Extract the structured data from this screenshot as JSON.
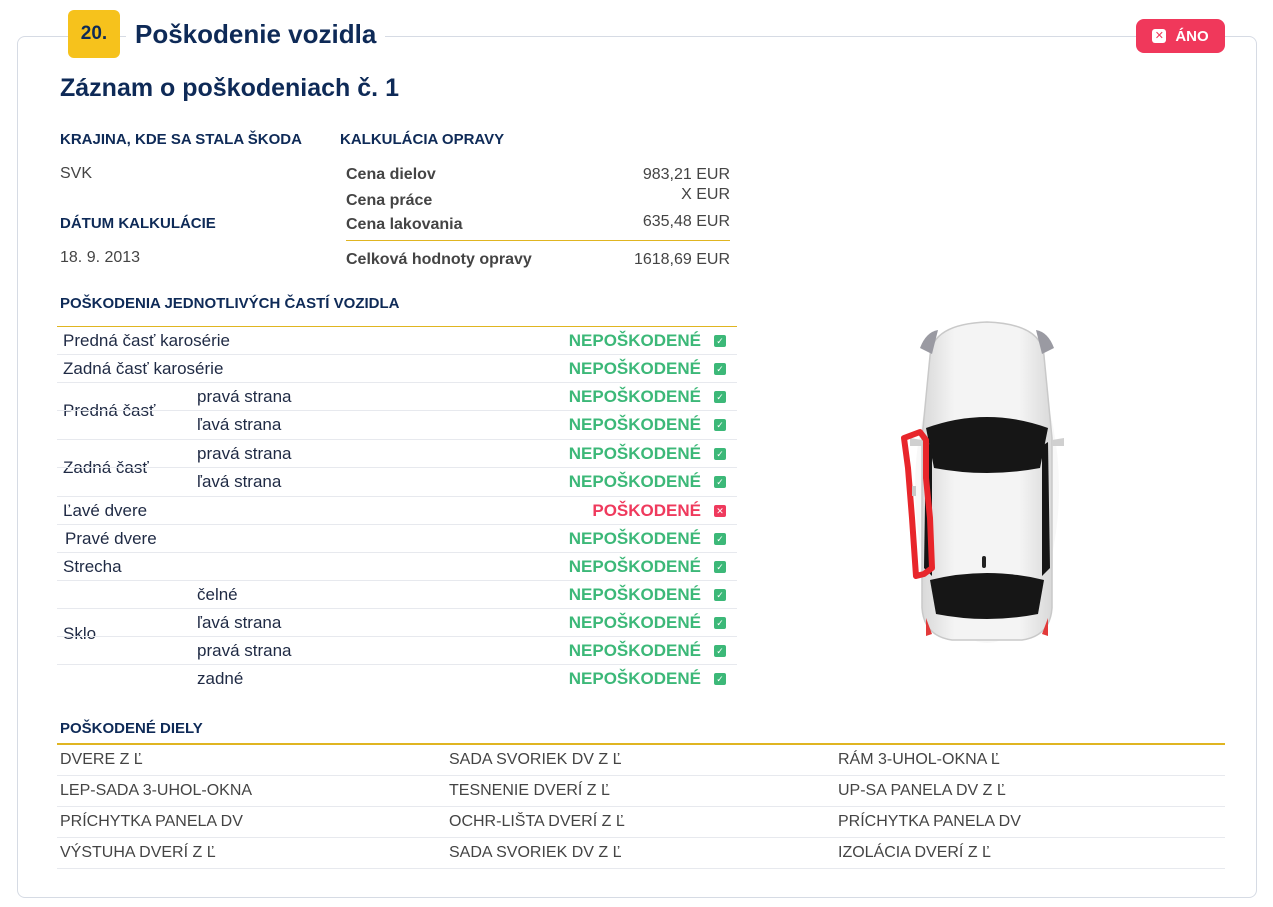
{
  "section": {
    "number": "20.",
    "title": "Poškodenie vozidla",
    "status_label": "ÁNO",
    "status_color": "#f0385b"
  },
  "record_title": "Záznam o poškodeniach č. 1",
  "country": {
    "label": "KRAJINA, KDE SA STALA ŠKODA",
    "value": "SVK"
  },
  "calc_date": {
    "label": "DÁTUM KALKULÁCIE",
    "value": "18. 9. 2013"
  },
  "calculation": {
    "label": "KALKULÁCIA OPRAVY",
    "rows": [
      {
        "name": "Cena dielov",
        "value": "983,21 EUR"
      },
      {
        "name": "Cena práce",
        "value": "X EUR"
      },
      {
        "name": "Cena lakovania",
        "value": "635,48 EUR"
      }
    ],
    "total": {
      "name": "Celková hodnoty opravy",
      "value": "1618,69 EUR"
    }
  },
  "parts": {
    "label": "POŠKODENIA JEDNOTLIVÝCH ČASTÍ VOZIDLA",
    "ok_text": "NEPOŠKODENÉ",
    "bad_text": "POŠKODENÉ",
    "ok_color": "#3cb878",
    "bad_color": "#ef3a5d",
    "front_body": "Predná časť karosérie",
    "rear_body": "Zadná časť karosérie",
    "front": {
      "name": "Predná časť",
      "right": "pravá strana",
      "left": "ľavá strana"
    },
    "rear": {
      "name": "Zadná časť",
      "right": "pravá strana",
      "left": "ľavá strana"
    },
    "left_door": "Ľavé dvere",
    "right_door": "Pravé dvere",
    "roof": "Strecha",
    "glass": {
      "name": "Sklo",
      "front": "čelné",
      "left": "ľavá strana",
      "right": "pravá strana",
      "rear": "zadné"
    }
  },
  "damaged_parts": {
    "label": "POŠKODENÉ DIELY",
    "rows": [
      [
        "DVERE Z Ľ",
        "SADA SVORIEK DV Z Ľ",
        "RÁM 3-UHOL-OKNA Ľ"
      ],
      [
        "LEP-SADA 3-UHOL-OKNA",
        "TESNENIE DVERÍ Z Ľ",
        "UP-SA PANELA DV Z Ľ"
      ],
      [
        "PRÍCHYTKA PANELA DV",
        "OCHR-LIŠTA DVERÍ Z Ľ",
        "PRÍCHYTKA PANELA DV"
      ],
      [
        "VÝSTUHA DVERÍ Z Ľ",
        "SADA SVORIEK DV Z Ľ",
        "IZOLÁCIA DVERÍ Z Ľ"
      ]
    ]
  },
  "icons": {
    "ok_check": "check-icon",
    "bad_check": "x-icon",
    "car": "car-top-view-icon"
  }
}
